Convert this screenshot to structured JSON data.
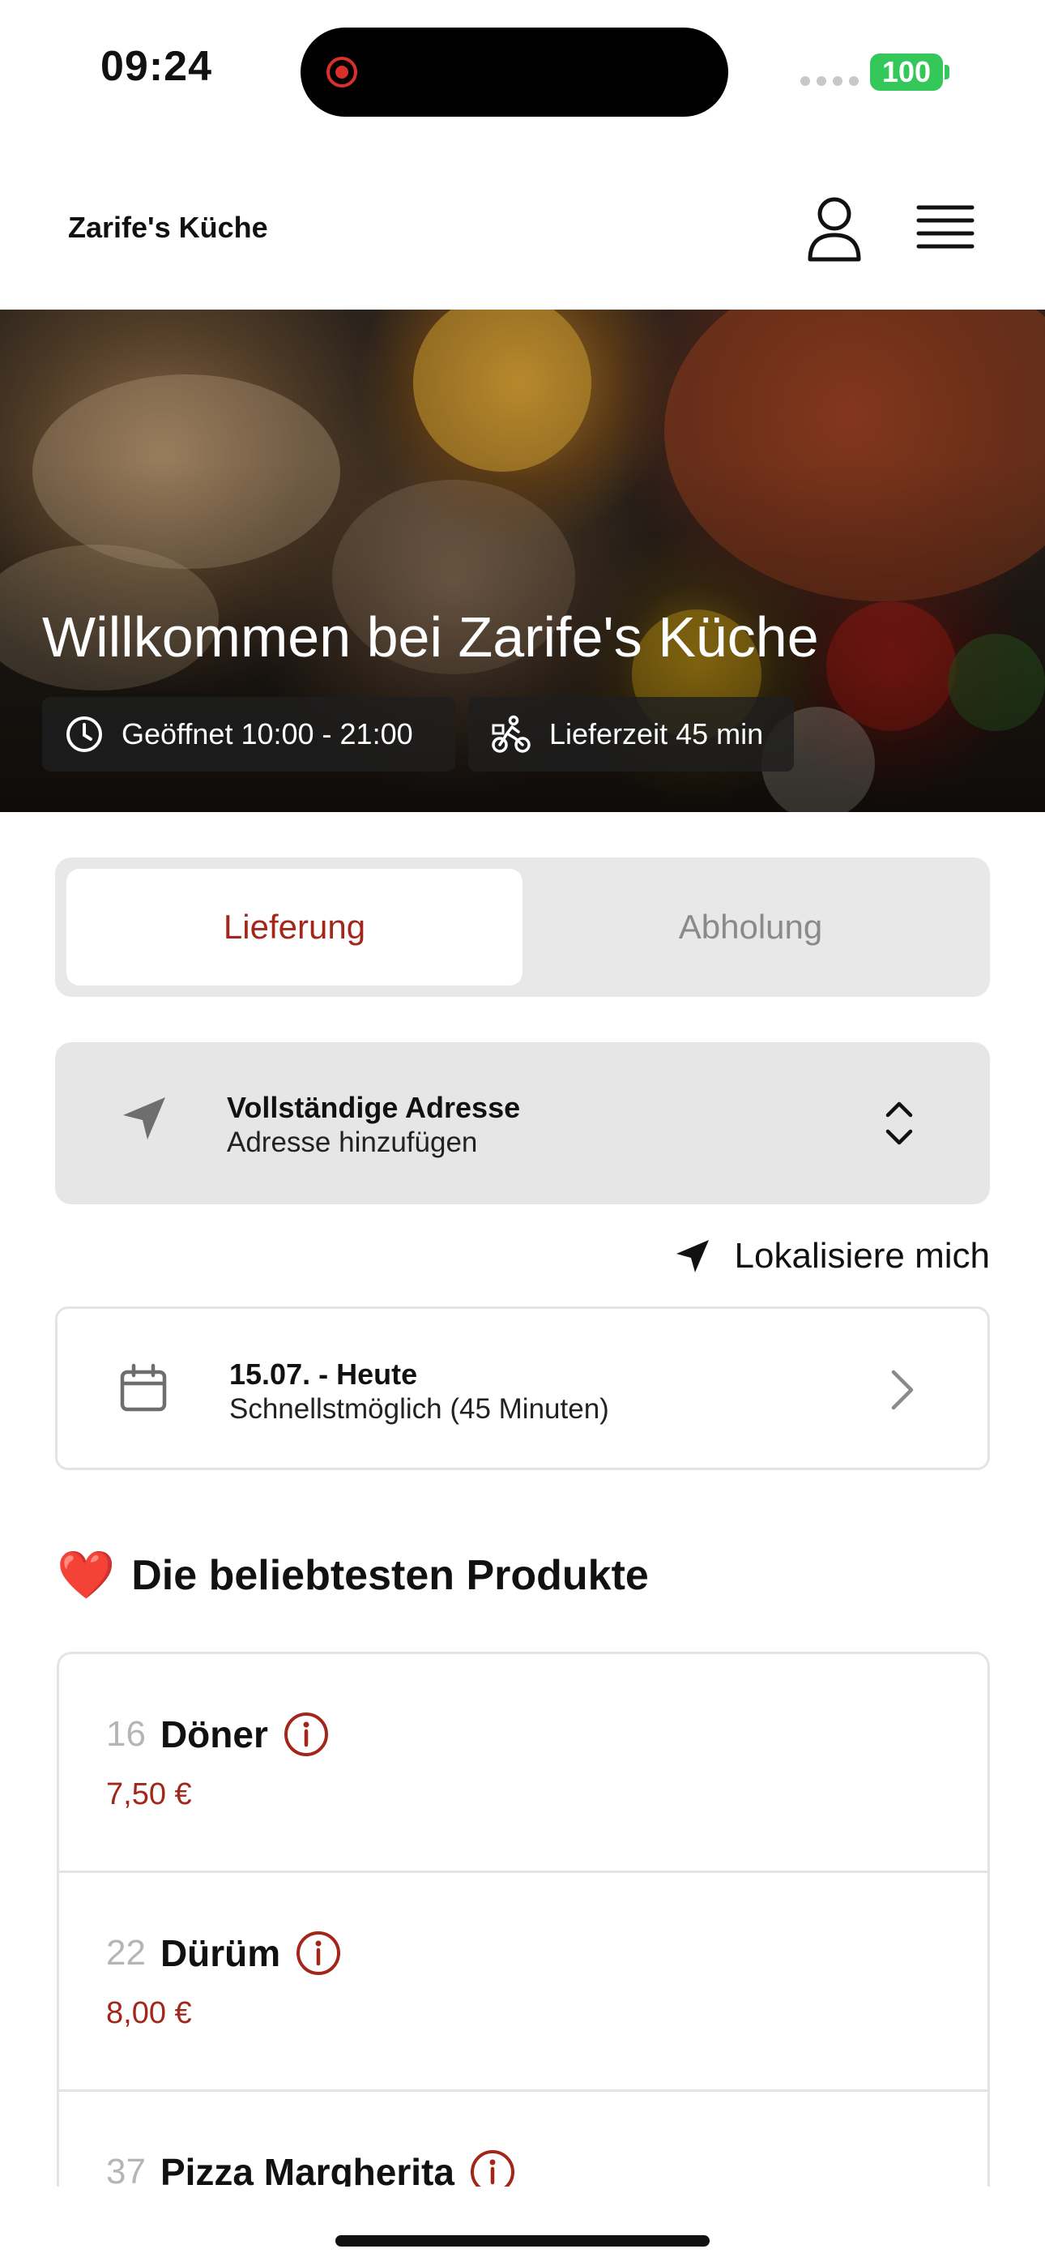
{
  "status_bar": {
    "time": "09:24",
    "battery": "100"
  },
  "header": {
    "brand": "Zarife's Küche",
    "user_icon": "user-icon",
    "menu_icon": "hamburger-menu-icon"
  },
  "hero": {
    "title": "Willkommen bei Zarife's Küche",
    "opening_hours": "Geöffnet 10:00 - 21:00",
    "delivery_time": "Lieferzeit 45 min"
  },
  "mode_tabs": {
    "delivery": "Lieferung",
    "pickup": "Abholung",
    "selected": "Lieferung"
  },
  "address": {
    "title": "Vollständige Adresse",
    "subtitle": "Adresse hinzufügen",
    "locate": "Lokalisiere mich"
  },
  "schedule": {
    "date": "15.07. - Heute",
    "time": "Schnellstmöglich (45 Minuten)"
  },
  "popular": {
    "heading": "Die beliebtesten Produkte",
    "emoji": "❤️",
    "items": [
      {
        "number": "16",
        "name": "Döner",
        "price": "7,50 €"
      },
      {
        "number": "22",
        "name": "Dürüm",
        "price": "8,00 €"
      },
      {
        "number": "37",
        "name": "Pizza Margherita",
        "price": ""
      }
    ]
  },
  "colors": {
    "accent": "#a3261b",
    "battery": "#34c759",
    "segment_bg": "#e8e8e8"
  }
}
